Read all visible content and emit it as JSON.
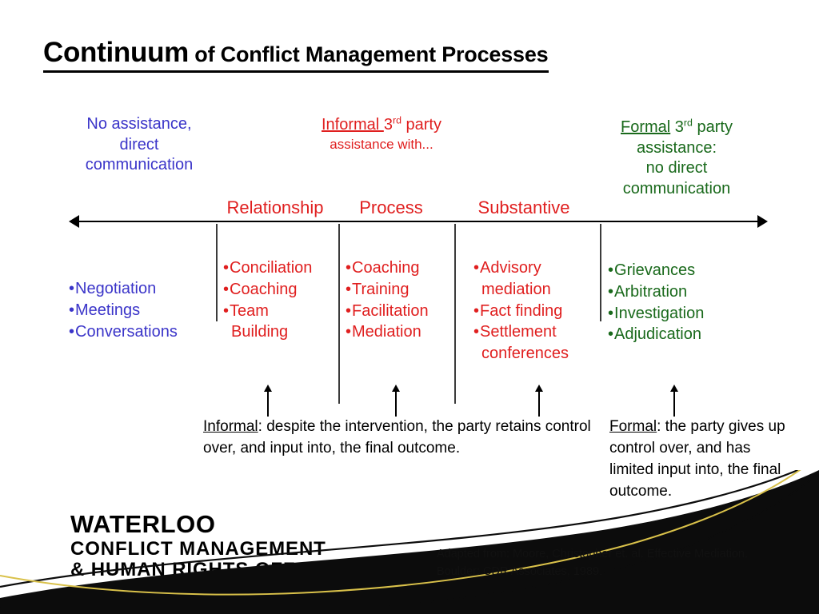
{
  "slide": {
    "title": {
      "main": "Continuum",
      "rest": " of Conflict Management Processes"
    },
    "zones": {
      "left": {
        "line1": "No assistance,",
        "line2": "direct",
        "line3": "communication"
      },
      "middle": {
        "label_underlined": "Informal ",
        "ordinal_number": "3",
        "ordinal_suffix": "rd",
        "label_rest": " party",
        "line2": "assistance with..."
      },
      "right": {
        "label_underlined": "Formal",
        "ordinal_number": " 3",
        "ordinal_suffix": "rd",
        "label_rest": " party",
        "line2": "assistance:",
        "line3": "no direct",
        "line4": "communication"
      }
    },
    "column_headers": {
      "relationship": "Relationship",
      "process": "Process",
      "substantive": "Substantive"
    },
    "lists": {
      "direct": [
        "Negotiation",
        "Meetings",
        "Conversations"
      ],
      "relationship": [
        "Conciliation",
        "Coaching",
        "Team\nBuilding"
      ],
      "process": [
        "Coaching",
        "Training",
        "Facilitation",
        "Mediation"
      ],
      "substantive": [
        "Advisory\nmediation",
        "Fact finding",
        "Settlement\nconferences"
      ],
      "formal": [
        "Grievances",
        "Arbitration",
        "Investigation",
        "Adjudication"
      ]
    },
    "notes": {
      "informal": {
        "label": "Informal",
        "text": ": despite the intervention, the party retains control over, and input into, the final outcome."
      },
      "formal": {
        "label": "Formal",
        "text": ": the party gives up control over, and has limited input into, the final outcome."
      }
    },
    "logo": {
      "line1": "WATERLOO",
      "line2": "CONFLICT MANAGEMENT",
      "line3": "& HUMAN RIGHTS OFFICE"
    },
    "citation": {
      "line1": "Adapted from: Moore, Christopher et. al. Effective Mediation.",
      "line2": "Boulder: CDR Associates, 1989."
    },
    "colors": {
      "blue": "#3b35c9",
      "red": "#e01f1f",
      "green": "#19691b",
      "black": "#000000",
      "gold": "#d9c14a"
    }
  }
}
